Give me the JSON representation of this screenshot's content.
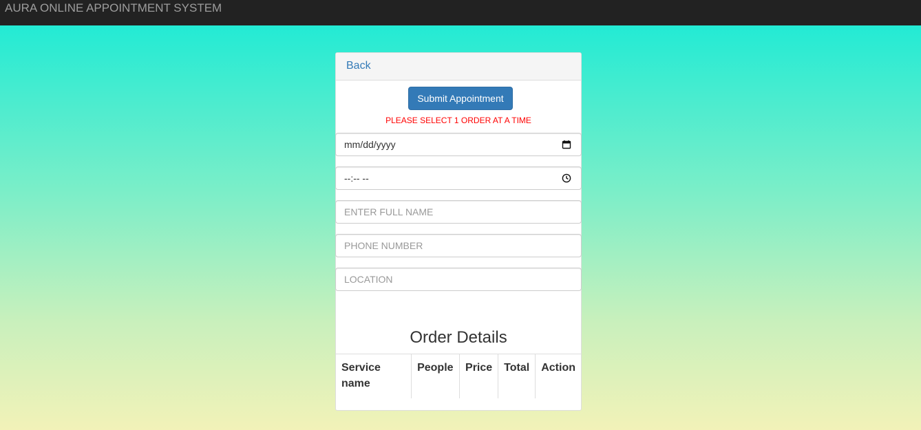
{
  "navbar": {
    "brand": "AURA ONLINE APPOINTMENT SYSTEM"
  },
  "panel": {
    "back_label": "Back",
    "submit_label": "Submit Appointment",
    "warning": "PLEASE SELECT 1 ORDER AT A TIME",
    "fields": {
      "date": {
        "value": "mm/dd/yyyy",
        "icon": "calendar-icon"
      },
      "time": {
        "value": "--:-- --",
        "icon": "clock-icon"
      },
      "full_name": {
        "placeholder": "ENTER FULL NAME"
      },
      "phone": {
        "placeholder": "PHONE NUMBER"
      },
      "location": {
        "placeholder": "LOCATION"
      }
    },
    "order": {
      "title": "Order Details",
      "columns": [
        "Service name",
        "People",
        "Price",
        "Total",
        "Action"
      ]
    }
  },
  "colors": {
    "navbar_bg": "#222222",
    "primary": "#337ab7",
    "warning": "#ff0000"
  }
}
